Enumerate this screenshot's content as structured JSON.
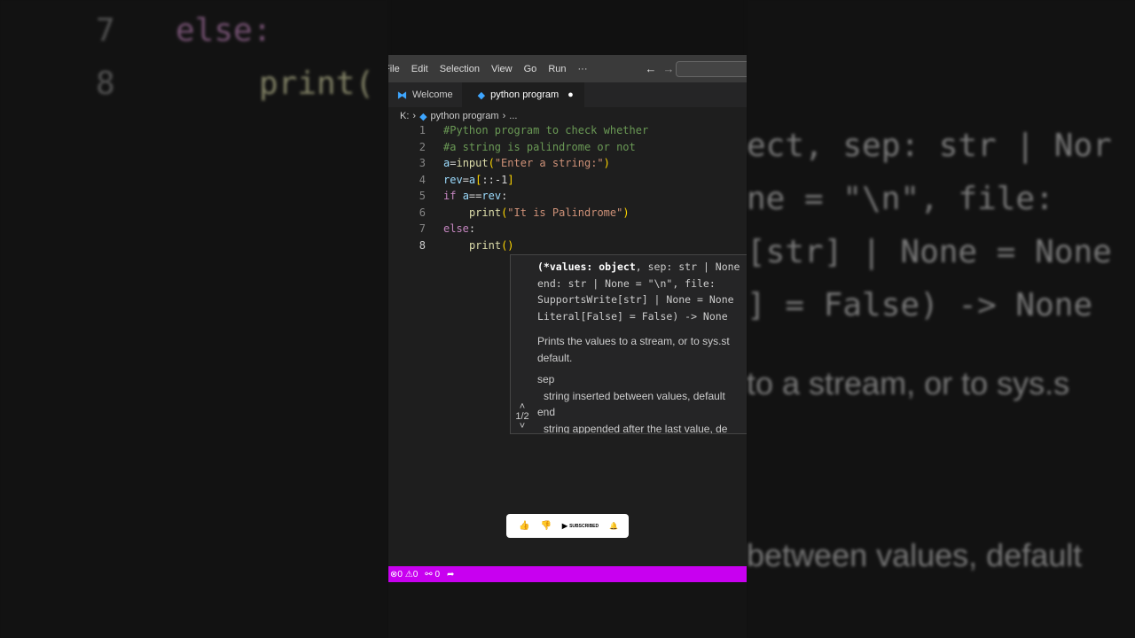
{
  "menu": [
    "File",
    "Edit",
    "Selection",
    "View",
    "Go",
    "Run",
    "···"
  ],
  "tabs": [
    {
      "label": "Welcome"
    },
    {
      "label": "python program",
      "modified": true
    }
  ],
  "breadcrumb": {
    "drive": "K:",
    "file": "python program",
    "more": "..."
  },
  "code": [
    {
      "n": "1",
      "t": "#Python program to check whether"
    },
    {
      "n": "2",
      "t": "#a string is palindrome or not"
    },
    {
      "n": "3",
      "t": "a=input(\"Enter a string:\")"
    },
    {
      "n": "4",
      "t": "rev=a[::-1]"
    },
    {
      "n": "5",
      "t": "if a==rev:"
    },
    {
      "n": "6",
      "t": "    print(\"It is Palindrome\")"
    },
    {
      "n": "7",
      "t": "else:"
    },
    {
      "n": "8",
      "t": "    print()"
    }
  ],
  "hover": {
    "sig": [
      "(*values: object, sep: str | None",
      "end: str | None = \"\\n\", file:",
      "SupportsWrite[str] | None = None",
      "Literal[False] = False) -> None"
    ],
    "desc": "Prints the values to a stream, or to sys.stdout by default.",
    "desc2": "default.",
    "desc1": "Prints the values to a stream, or to sys.st",
    "p1": "sep",
    "p1d": "string inserted between values, default",
    "p2": "end",
    "p2d": "string appended after the last value, de",
    "pager": "1/2"
  },
  "yt": {
    "subscribed": "SUBSCRIBED"
  },
  "status": {
    "errors": "0",
    "warnings": "0",
    "ports": "0"
  },
  "bg_left": [
    "7",
    "else:",
    "8",
    "print("
  ],
  "bg_right": [
    "ect, sep: str | Nor",
    "ne = \"\\n\", file:",
    "[str] | None = None",
    "] = False) -> None",
    "to a stream, or to sys.s",
    "between values, default"
  ]
}
